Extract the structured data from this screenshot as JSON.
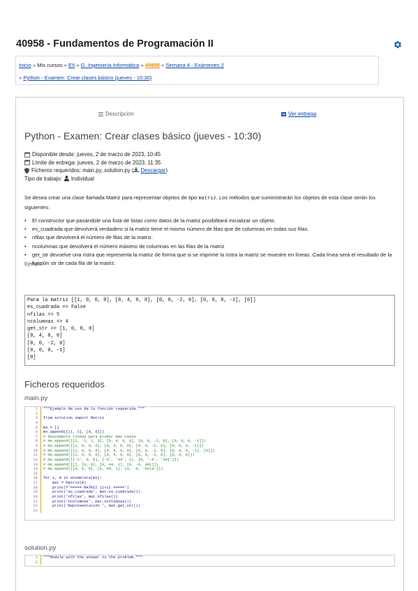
{
  "course": {
    "title": "40958 - Fundamentos de Programación II"
  },
  "breadcrumb": {
    "items": [
      "Inicio",
      "Mis cursos",
      "EII",
      "G. Ingeniería Informática",
      "40958",
      "Semana 4 - Exámenes 2"
    ],
    "current": "Python - Examen: Crear clases básico (jueves - 10:30)",
    "separator": "»"
  },
  "tabs": {
    "description": "Descripción",
    "submission": "Ver entrega"
  },
  "activity": {
    "title": "Python - Examen: Crear clases básico (jueves - 10:30)",
    "available_from": "Disponible desde: jueves, 2 de marzo de 2023, 10:45",
    "due_date": "Límite de entrega: jueves, 2 de marzo de 2023, 11:35",
    "required_files_label": "Ficheros requeridos: main.py, solution.py (",
    "download": "Descargar",
    "required_files_close": ")",
    "work_type_label": "Tipo de trabajo:",
    "work_type": "Individual"
  },
  "intro": {
    "a": "Se desea crear una clase llamada Matriz para representar objetos de tipo ",
    "code": "matriz",
    "b": ". Los métodos que suministrarán los objetos de esta clase serán los siguientes:"
  },
  "bullets": [
    "El constructor que pasándole una lista de listas como datos de la matriz posibilitará inicializar un objeto.",
    "es_cuadrada que devolverá verdadero si la matriz tiene el mismo número de filas que de columnas en todas sus filas.",
    "nfilas que devolverá el número de filas de la matriz.",
    "ncolumnas que devolverá el número máximo de columnas en las filas de la matriz",
    "get_str devuelve una ristra que representa la matriz de forma que si se imprime la ristra la matriz se muestre en líneas. Cada línea será el resultado de la función str de cada fila de la matriz."
  ],
  "example": {
    "label": "Ejemplo:",
    "text": "Para la matriz [[1, 0, 0, 0], [0, 4, 0, 0], [0, 0, -2, 0], [0, 0, 0, -1], [0]]\nes_cuadrada => False\nnfilas => 5\nncolumnas => 4\nget_str => [1, 0, 0, 0]\n[0, 4, 0, 0]\n[0, 0, -2, 0]\n[0, 0, 0, -1]\n[0]"
  },
  "files": {
    "heading": "Ficheros requeridos",
    "main_name": "main.py",
    "solution_name": "solution.py",
    "main_lines": [
      "\"\"\"Ejemplo de uso de la función requerida.\"\"\"",
      "",
      "from solution import Matriz",
      "",
      "ms = []",
      "ms.append([[1, 1], [0, 0]])",
      "# Descomente líneas para probar más casos",
      "# ms.append([[1, -1, 2, 3], [0, 4, 0, 0], [0, 0, -2, 0], [0, 0, 0, -1]])",
      "# ms.append([[1, 0, 0, 0], [0, 4, 0, 0], [0, 0, -2, 0], [0, 0, 0, -1]])",
      "# ms.append([[1, 0, 0, 0], [0, 4, 0, 0], [0, 0, -2, 0], [0, 0, 0, -1], [0]])",
      "# ms.append([[1, 0, 0, 0], [0, 4, 0, 0], [0, 0, -2, 0], [0, 0, 0]])",
      "# ms.append([['1', 0, 0], ['0', '44', 1], [0, '-0', '341']])",
      "# ms.append([[], [0, 0], [0, 44, 1], [0, -0, 341]])",
      "# ms.append([[4, 0, 0], [0, 44, 1], [0, -0, 'hola']])",
      "",
      "for i, m in enumerate(ms):",
      "    mat = Matriz(m)",
      "    print(f'===== MATRIZ {i+1} =====')",
      "    print('es_cuadrada', mat.es_cuadrada())",
      "    print('nfilas', mat.nfilas())",
      "    print('ncolumnas', mat.ncolumnas())",
      "    print('Representación ', mat.get_str())",
      ""
    ],
    "solution_lines": [
      "\"\"\"Module with the answer to the problem.\"\"\"",
      ""
    ]
  },
  "colors": {
    "link": "#0645ad",
    "course_highlight": "#e08a00",
    "gear": "#1a5fb4"
  }
}
